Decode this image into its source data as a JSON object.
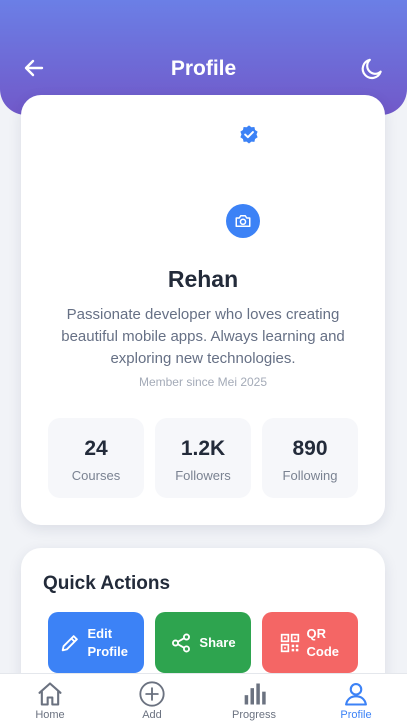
{
  "header": {
    "title": "Profile",
    "back_icon": "arrow-left-icon",
    "theme_icon": "moon-icon"
  },
  "profile": {
    "name": "Rehan",
    "bio": "Passionate developer who loves creating beautiful mobile apps. Always learning and exploring new technologies.",
    "member_since": "Member since Mei 2025",
    "verified_icon": "verified-badge-icon",
    "camera_icon": "camera-icon"
  },
  "stats": [
    {
      "value": "24",
      "label": "Courses"
    },
    {
      "value": "1.2K",
      "label": "Followers"
    },
    {
      "value": "890",
      "label": "Following"
    }
  ],
  "quick_actions": {
    "title": "Quick Actions",
    "items": [
      {
        "label": "Edit Profile",
        "icon": "pencil-icon",
        "color": "#3c82f6"
      },
      {
        "label": "Share",
        "icon": "share-icon",
        "color": "#2ea44f"
      },
      {
        "label": "QR Code",
        "icon": "qr-code-icon",
        "color": "#f46665"
      }
    ]
  },
  "bottom_nav": {
    "items": [
      {
        "label": "Home",
        "icon": "home-icon"
      },
      {
        "label": "Add",
        "icon": "plus-circle-icon"
      },
      {
        "label": "Progress",
        "icon": "bar-chart-icon"
      },
      {
        "label": "Profile",
        "icon": "user-icon",
        "active": true
      }
    ]
  },
  "colors": {
    "header_gradient_top": "#6b7fe6",
    "header_gradient_bottom": "#7159c9",
    "accent": "#3c82f6"
  }
}
